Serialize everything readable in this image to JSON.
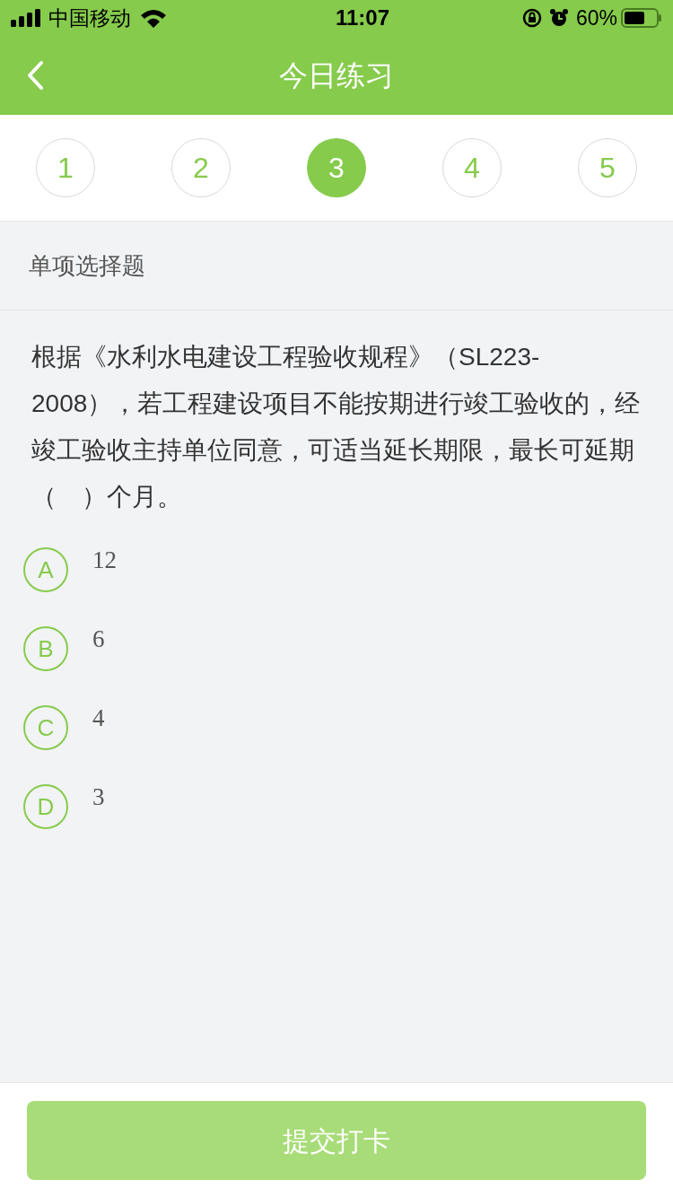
{
  "status_bar": {
    "carrier": "中国移动",
    "time": "11:07",
    "battery": "60%"
  },
  "nav": {
    "title": "今日练习"
  },
  "question_tabs": [
    {
      "label": "1",
      "selected": false
    },
    {
      "label": "2",
      "selected": false
    },
    {
      "label": "3",
      "selected": true
    },
    {
      "label": "4",
      "selected": false
    },
    {
      "label": "5",
      "selected": false
    }
  ],
  "section": {
    "title": "单项选择题"
  },
  "question": {
    "text": "根据《水利水电建设工程验收规程》（SL223-2008），若工程建设项目不能按期进行竣工验收的，经竣工验收主持单位同意，可适当延长期限，最长可延期（　）个月。"
  },
  "options": [
    {
      "letter": "A",
      "text": "12",
      "selected": false
    },
    {
      "letter": "B",
      "text": "6",
      "selected": false
    },
    {
      "letter": "C",
      "text": "4",
      "selected": false
    },
    {
      "letter": "D",
      "text": "3",
      "selected": false
    }
  ],
  "submit": {
    "label": "提交打卡",
    "disabled": true
  }
}
